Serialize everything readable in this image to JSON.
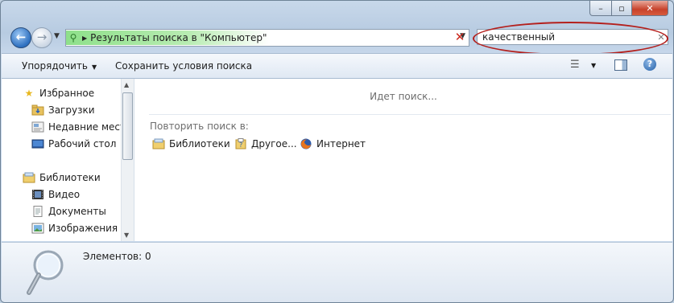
{
  "window": {
    "controls": {
      "minimize": "–",
      "maximize": "▫",
      "close": "✕"
    }
  },
  "nav": {
    "back_icon": "back-arrow-icon",
    "forward_icon": "forward-arrow-icon"
  },
  "address_bar": {
    "path_text": "Результаты поиска в \"Компьютер\"",
    "accent_color": "#8ee08a"
  },
  "search": {
    "value": "качественный",
    "highlight_color": "#b4201d"
  },
  "toolbar": {
    "organize_label": "Упорядочить",
    "save_search_label": "Сохранить условия поиска"
  },
  "sidebar": {
    "items": [
      {
        "label": "Избранное",
        "icon": "star-icon"
      },
      {
        "label": "Загрузки",
        "icon": "downloads-folder-icon"
      },
      {
        "label": "Недавние места",
        "icon": "recent-places-icon"
      },
      {
        "label": "Рабочий стол",
        "icon": "desktop-icon"
      },
      {
        "label": "Библиотеки",
        "icon": "libraries-icon"
      },
      {
        "label": "Видео",
        "icon": "video-icon"
      },
      {
        "label": "Документы",
        "icon": "documents-icon"
      },
      {
        "label": "Изображения",
        "icon": "pictures-icon"
      }
    ]
  },
  "main": {
    "status": "Идет поиск...",
    "repeat_label": "Повторить поиск в:",
    "locations": [
      {
        "label": "Библиотеки",
        "icon": "libraries-icon"
      },
      {
        "label": "Другое...",
        "icon": "other-folder-icon"
      },
      {
        "label": "Интернет",
        "icon": "firefox-icon"
      }
    ]
  },
  "details": {
    "count_label": "Элементов: 0"
  }
}
